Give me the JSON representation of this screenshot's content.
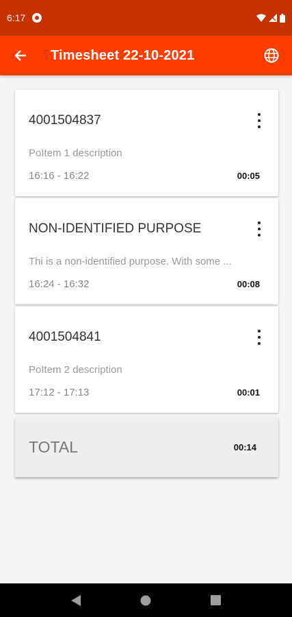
{
  "status_bar": {
    "time": "6:17"
  },
  "app_bar": {
    "title": "Timesheet 22-10-2021"
  },
  "entries": [
    {
      "title": "4001504837",
      "description": "PoItem 1 description",
      "time_range": "16:16 - 16:22",
      "duration": "00:05"
    },
    {
      "title": "NON-IDENTIFIED PURPOSE",
      "description": "Thi is a non-identified purpose. With some ...",
      "time_range": "16:24 - 16:32",
      "duration": "00:08"
    },
    {
      "title": "4001504841",
      "description": "PoItem 2 description",
      "time_range": "17:12 - 17:13",
      "duration": "00:01"
    }
  ],
  "total": {
    "label": "TOTAL",
    "value": "00:14"
  },
  "colors": {
    "primary": "#ff3d00",
    "status_bar": "#c63100"
  }
}
